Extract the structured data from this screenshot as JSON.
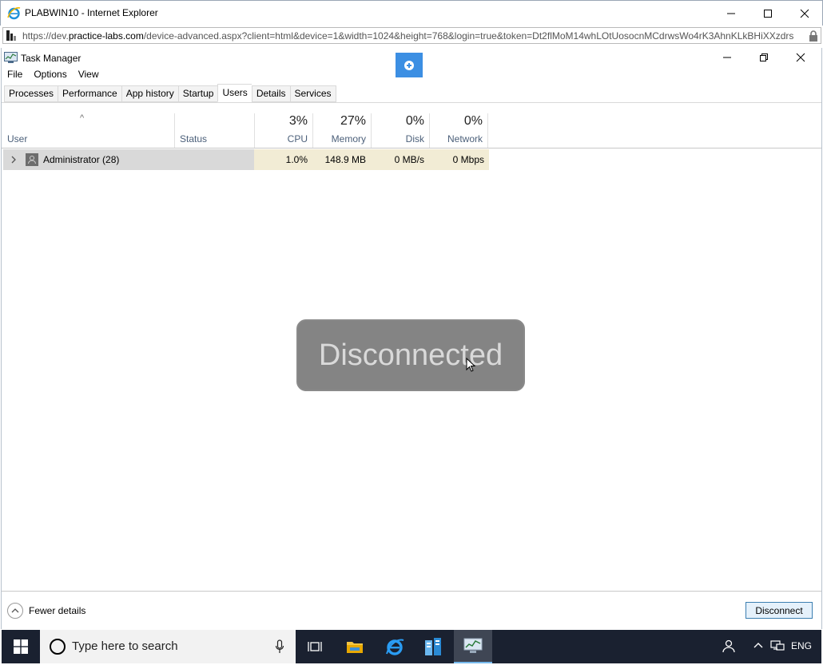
{
  "browser": {
    "title": "PLABWIN10 - Internet Explorer",
    "url_prefix": "https://dev.",
    "url_host": "practice-labs.com",
    "url_rest": "/device-advanced.aspx?client=html&device=1&width=1024&height=768&login=true&token=Dt2flMoM14whLOtUosocnMCdrwsWo4rK3AhnKLkBHiXXzdrs"
  },
  "taskmanager": {
    "title": "Task Manager",
    "menu": [
      "File",
      "Options",
      "View"
    ],
    "tabs": [
      "Processes",
      "Performance",
      "App history",
      "Startup",
      "Users",
      "Details",
      "Services"
    ],
    "active_tab": "Users",
    "columns": {
      "user": "User",
      "status": "Status",
      "cpu": {
        "pct": "3%",
        "label": "CPU"
      },
      "memory": {
        "pct": "27%",
        "label": "Memory"
      },
      "disk": {
        "pct": "0%",
        "label": "Disk"
      },
      "network": {
        "pct": "0%",
        "label": "Network"
      }
    },
    "rows": [
      {
        "user": "Administrator (28)",
        "status": "",
        "cpu": "1.0%",
        "memory": "148.9 MB",
        "disk": "0 MB/s",
        "network": "0 Mbps"
      }
    ],
    "fewer_details": "Fewer details",
    "disconnect_label": "Disconnect"
  },
  "overlay": {
    "text": "Disconnected"
  },
  "taskbar": {
    "search_placeholder": "Type here to search",
    "language": "ENG"
  },
  "colors": {
    "rdp_button": "#3c8fe3",
    "taskbar": "#1a2130",
    "heat_cell": "#f2ecd5",
    "selected_row": "#d9d9d9"
  }
}
